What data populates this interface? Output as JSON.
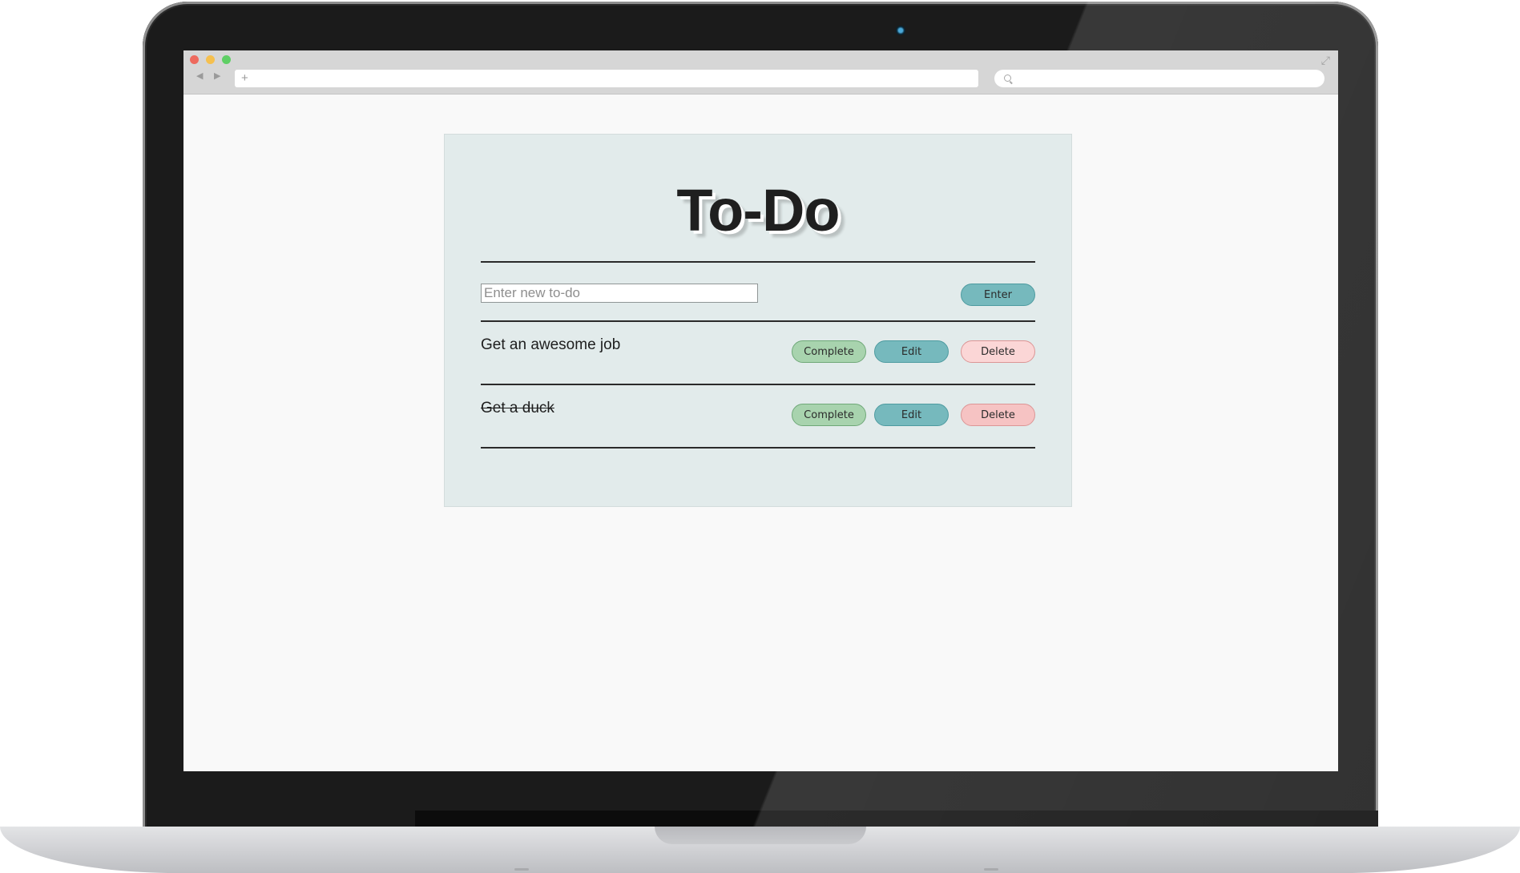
{
  "app": {
    "title": "To-Do"
  },
  "browser": {
    "back_icon": "left-arrow-icon",
    "forward_icon": "right-arrow-icon",
    "new_tab_icon": "plus-icon",
    "search_icon": "search-icon",
    "fullscreen_icon": "expand-icon"
  },
  "new_todo": {
    "placeholder": "Enter new to-do",
    "value": "",
    "enter_label": "Enter"
  },
  "todos": [
    {
      "text": "Get an awesome job",
      "completed": false,
      "complete_label": "Complete",
      "edit_label": "Edit",
      "delete_label": "Delete"
    },
    {
      "text": "Get a duck",
      "completed": true,
      "complete_label": "Complete",
      "edit_label": "Edit",
      "delete_label": "Delete"
    }
  ],
  "colors": {
    "panel_background": "#e2ebeb",
    "complete_button": "#a8d3ae",
    "edit_button": "#76b9bd",
    "delete_button": "#f6c3c3"
  }
}
